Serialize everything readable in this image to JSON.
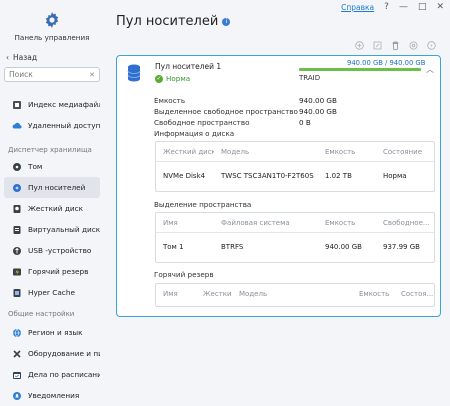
{
  "window": {
    "help_link": "Справка",
    "controls": [
      "?",
      "—",
      "□",
      "✕"
    ]
  },
  "sidebar": {
    "title": "Панель управления",
    "back_label": "Назад",
    "search_placeholder": "Поиск",
    "items_top": [
      {
        "label": "Индекс медиафайлов",
        "icon": "media-index-icon"
      },
      {
        "label": "Удаленный доступ",
        "icon": "remote-access-icon"
      }
    ],
    "section_storage": "Диспетчер хранилища",
    "storage_items": [
      {
        "label": "Том",
        "icon": "volume-icon"
      },
      {
        "label": "Пул носителей",
        "icon": "storage-pool-icon",
        "active": true
      },
      {
        "label": "Жесткий диск",
        "icon": "hard-disk-icon"
      },
      {
        "label": "Виртуальный диск",
        "icon": "virtual-disk-icon"
      },
      {
        "label": "USB -устройство",
        "icon": "usb-icon"
      },
      {
        "label": "Горячий резерв",
        "icon": "hot-spare-icon"
      },
      {
        "label": "Hyper Cache",
        "icon": "hyper-cache-icon"
      }
    ],
    "section_general": "Общие настройки",
    "general_items": [
      {
        "label": "Регион и язык",
        "icon": "region-language-icon"
      },
      {
        "label": "Оборудование и пит...",
        "icon": "hardware-power-icon"
      },
      {
        "label": "Дела по расписанию",
        "icon": "scheduled-tasks-icon"
      },
      {
        "label": "Уведомления",
        "icon": "notifications-icon"
      }
    ]
  },
  "main": {
    "title": "Пул носителей",
    "toolbar": [
      "add-icon",
      "edit-icon",
      "delete-icon",
      "settings-icon",
      "more-icon"
    ]
  },
  "pool": {
    "name": "Пул носителей 1",
    "status": "Норма",
    "usage_text": "940.00 GB / 940.00 GB",
    "usage_fraction": 1.0,
    "raid": "TRAID",
    "properties": [
      {
        "key": "Емкость",
        "value": "940.00 GB"
      },
      {
        "key": "Выделенное свободное пространство",
        "value": "940.00 GB"
      },
      {
        "key": "Свободное пространство",
        "value": "0 B"
      }
    ],
    "disk_info": {
      "label": "Информация о диска",
      "headers": [
        "Жесткий диск",
        "Модель",
        "Емкость",
        "Состояние"
      ],
      "rows": [
        [
          "NVMe Disk4",
          "TWSC TSC3AN1T0-F2T60S",
          "1.02 TB",
          "Норма"
        ]
      ]
    },
    "space_alloc": {
      "label": "Выделение пространства",
      "headers": [
        "Имя",
        "Файловая система",
        "Емкость",
        "Свободное..."
      ],
      "rows": [
        [
          "Том 1",
          "BTRFS",
          "940.00 GB",
          "937.99 GB"
        ]
      ]
    },
    "hot_spare": {
      "label": "Горячий резерв",
      "headers": [
        "Имя",
        "Жестки...",
        "Модель",
        "Емкость",
        "Состоя..."
      ]
    }
  },
  "colors": {
    "accent": "#3da2e0",
    "ok": "#5aad2f",
    "link": "#1e78d6"
  }
}
